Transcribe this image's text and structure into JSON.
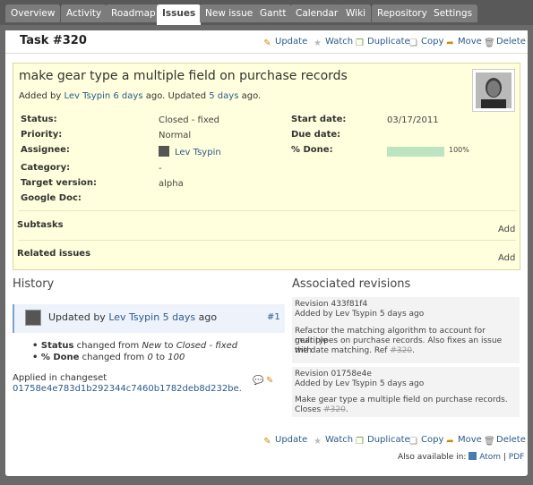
{
  "tabs": [
    "Overview",
    "Activity",
    "Roadmap",
    "Issues",
    "New issue",
    "Gantt",
    "Calendar",
    "Wiki",
    "Repository",
    "Settings"
  ],
  "title": "Task #320",
  "actions": {
    "update": "Update",
    "watch": "Watch",
    "duplicate": "Duplicate",
    "copy": "Copy",
    "move": "Move",
    "delete": "Delete"
  },
  "issue": {
    "subject": "make gear type a multiple field on purchase records",
    "added_by_prefix": "Added by",
    "author": "Lev Tsypin",
    "added_ago": "6 days",
    "ago_updated": "ago. Updated",
    "updated_ago": "5 days",
    "ago_end": "ago.",
    "fields": {
      "status_label": "Status:",
      "status": "Closed - fixed",
      "priority_label": "Priority:",
      "priority": "Normal",
      "assignee_label": "Assignee:",
      "assignee": "Lev Tsypin",
      "category_label": "Category:",
      "category": "-",
      "target_label": "Target version:",
      "target": "alpha",
      "gdoc_label": "Google Doc:",
      "start_label": "Start date:",
      "start": "03/17/2011",
      "due_label": "Due date:",
      "done_label": "% Done:",
      "done_value": "100%",
      "done_fraction": 1.0
    },
    "subtasks_label": "Subtasks",
    "related_label": "Related issues",
    "add_label": "Add"
  },
  "history": {
    "heading": "History",
    "updated_by": "Updated by",
    "author": "Lev Tsypin",
    "ago": "5 days",
    "ago_word": "ago",
    "number": "#1",
    "status_field": "Status",
    "status_changed": "changed from",
    "status_from": "New",
    "to_word": "to",
    "status_to": "Closed - fixed",
    "done_field": "% Done",
    "done_changed": "changed from",
    "done_from": "0",
    "done_to": "100",
    "applied": "Applied in changeset",
    "changeset": "01758e4e783d1b292344c7460b1782deb8d232be."
  },
  "revisions": {
    "heading": "Associated revisions",
    "items": [
      {
        "title": "Revision 433f81f4",
        "added_by": "Added by Lev Tsypin 5 days ago",
        "msg1": "Refactor the matching algorithm to account for multiple",
        "msg2": "gear types on purchase records. Also fixes an issue with",
        "msg3": "the date matching. Ref",
        "ref": "#320",
        "end": "."
      },
      {
        "title": "Revision 01758e4e",
        "added_by": "Added by Lev Tsypin 5 days ago",
        "msg1": "Make gear type a multiple field on purchase records.",
        "msg2": "Closes",
        "ref": "#320",
        "end": "."
      }
    ]
  },
  "also_available": "Also available in:",
  "atom": "Atom",
  "pipe": "|",
  "pdf": "PDF"
}
